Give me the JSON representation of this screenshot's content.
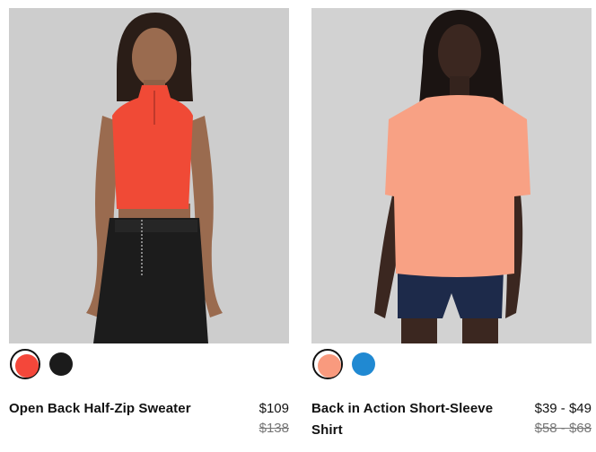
{
  "products": [
    {
      "name": "Open Back Half-Zip Sweater",
      "price": "$109",
      "original_price": "$138",
      "image_alt": "",
      "swatches": [
        {
          "color": "#f4473a",
          "selected": true
        },
        {
          "color": "#1b1b1b",
          "selected": false
        }
      ]
    },
    {
      "name": "Back in Action Short-Sleeve Shirt",
      "price": "$39 - $49",
      "original_price": "$58 - $68",
      "image_alt": "",
      "swatches": [
        {
          "color": "#f99a7e",
          "selected": true
        },
        {
          "color": "#2089d2",
          "selected": false
        }
      ]
    }
  ]
}
